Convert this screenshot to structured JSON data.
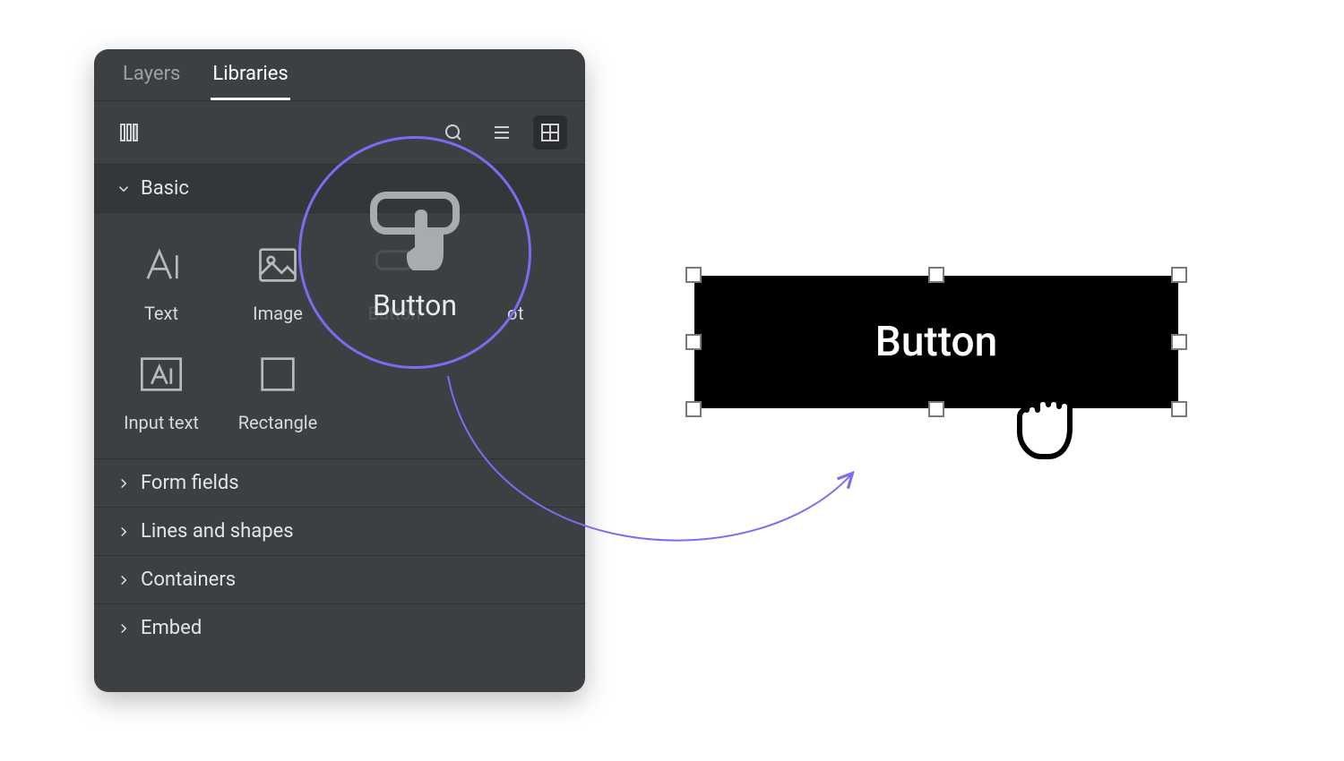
{
  "tabs": {
    "layers": "Layers",
    "libraries": "Libraries"
  },
  "sections": {
    "basic": "Basic",
    "form_fields": "Form fields",
    "lines_shapes": "Lines and shapes",
    "containers": "Containers",
    "embed": "Embed"
  },
  "components": {
    "text": "Text",
    "image": "Image",
    "button": "Button",
    "hotspot_partial": "ot",
    "input_text": "Input text",
    "rectangle": "Rectangle"
  },
  "highlight": {
    "label": "Button"
  },
  "canvas": {
    "button_label": "Button"
  },
  "colors": {
    "accent": "#7b6df2",
    "panel_bg": "#3d4043"
  }
}
